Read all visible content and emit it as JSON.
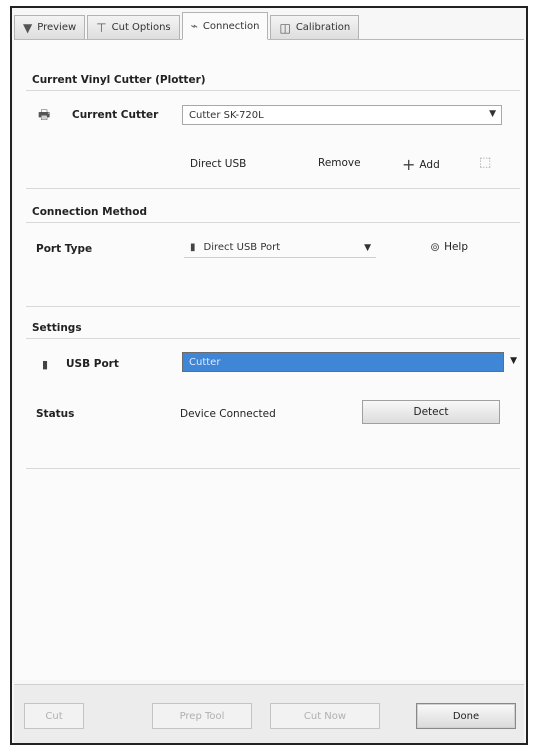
{
  "tabs": [
    {
      "label": "Preview",
      "icon": "triangle-down-icon"
    },
    {
      "label": "Cut Options",
      "icon": "cutter-icon"
    },
    {
      "label": "Connection",
      "icon": "plug-icon"
    },
    {
      "label": "Calibration",
      "icon": "calibration-icon"
    }
  ],
  "current_cutter": {
    "section_title": "Current Vinyl Cutter (Plotter)",
    "label": "Current Cutter",
    "value": "Cutter SK-720L",
    "connection_type": "Direct USB",
    "remove_label": "Remove",
    "add_label": "Add"
  },
  "connection_method": {
    "section_title": "Connection Method",
    "port_type_label": "Port Type",
    "port_type_value": "Direct USB Port",
    "help_label": "Help"
  },
  "settings": {
    "section_title": "Settings",
    "usb_port_label": "USB Port",
    "usb_port_value": "Cutter",
    "status_label": "Status",
    "status_value": "Device Connected",
    "detect_label": "Detect"
  },
  "footer": {
    "cut_label": "Cut",
    "prep_label": "Prep Tool",
    "cut_now_label": "Cut Now",
    "done_label": "Done"
  }
}
